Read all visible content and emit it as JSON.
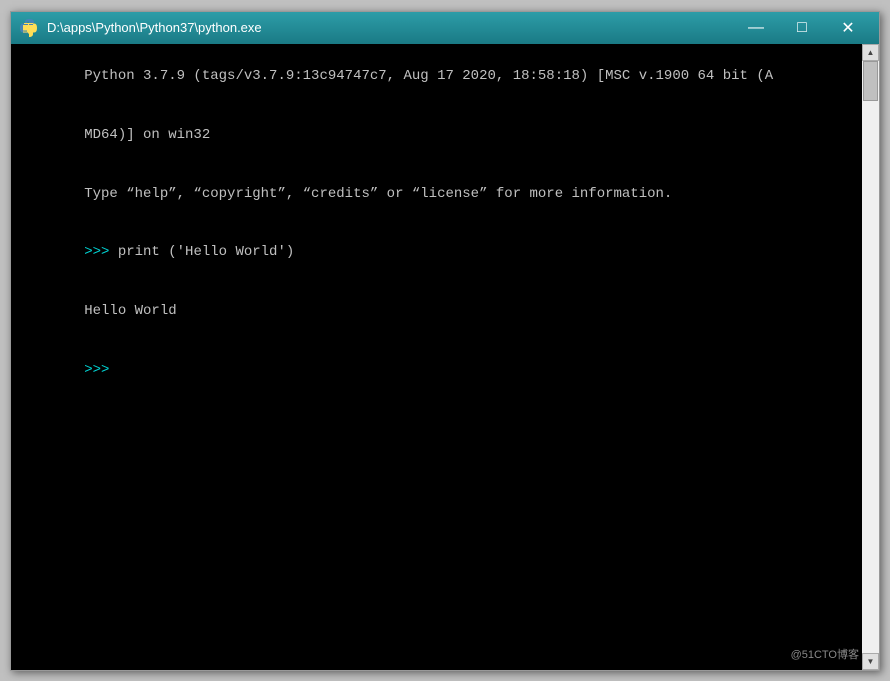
{
  "window": {
    "title": "D:\\apps\\Python\\Python37\\python.exe",
    "icon": "python-icon"
  },
  "controls": {
    "minimize": "—",
    "maximize": "□",
    "close": "✕"
  },
  "terminal": {
    "line1": "Python 3.7.9 (tags/v3.7.9:13c94747c7, Aug 17 2020, 18:58:18) [MSC v.1900 64 bit (A",
    "line2": "MD64)] on win32",
    "line3": "Type “help”, “copyright”, “credits” or “license” for more information.",
    "prompt1": ">>> ",
    "command1": "print ('Hello World')",
    "output1": "Hello World",
    "prompt2": ">>> "
  },
  "watermark": "@51CTO博客"
}
